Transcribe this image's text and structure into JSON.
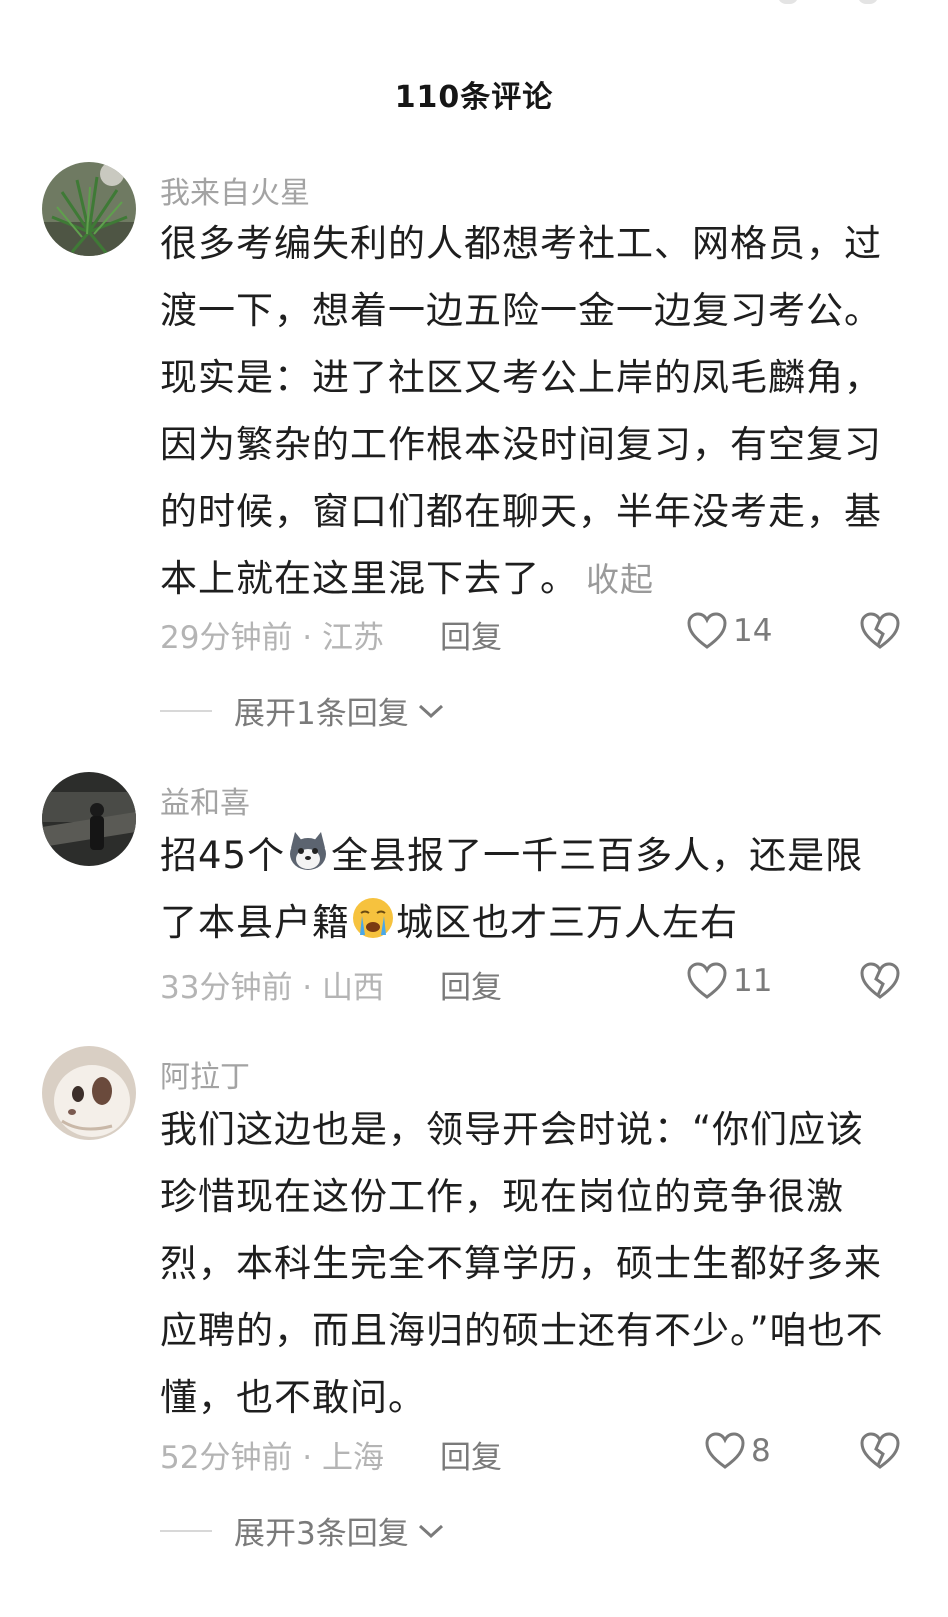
{
  "header": {
    "title": "110条评论"
  },
  "comments": [
    {
      "username": "我来自火星",
      "text": "很多考编失利的人都想考社工、网格员，过渡一下，想着一边五险一金一边复习考公。现实是：进了社区又考公上岸的凤毛麟角，因为繁杂的工作根本没时间复习，有空复习的时候，窗口们都在聊天，半年没考走，基本上就在这里混下去了。",
      "collapse_label": "收起",
      "time_location": "29分钟前 · 江苏",
      "reply_label": "回复",
      "likes": "14",
      "expand_label": "展开1条回复"
    },
    {
      "username": "益和喜",
      "text_part1": "招45个",
      "text_part2": "全县报了一千三百多人，还是限了本县户籍",
      "text_part3": "城区也才三万人左右",
      "emoji1": "husky-emoji",
      "emoji2": "crying-emoji",
      "time_location": "33分钟前 · 山西",
      "reply_label": "回复",
      "likes": "11"
    },
    {
      "username": "阿拉丁",
      "text": "我们这边也是，领导开会时说：“你们应该珍惜现在这份工作，现在岗位的竞争很激烈，本科生完全不算学历，硕士生都好多来应聘的，而且海归的硕士还有不少。”咱也不懂，也不敢问。",
      "time_location": "52分钟前 · 上海",
      "reply_label": "回复",
      "likes": "8",
      "expand_label": "展开3条回复"
    }
  ],
  "icons": {
    "like": "heart-outline-icon",
    "dislike": "broken-heart-icon",
    "expand": "chevron-down-icon"
  },
  "colors": {
    "username": "#a3a3a3",
    "meta": "#b4b4b4",
    "text": "#1e1e1e"
  }
}
